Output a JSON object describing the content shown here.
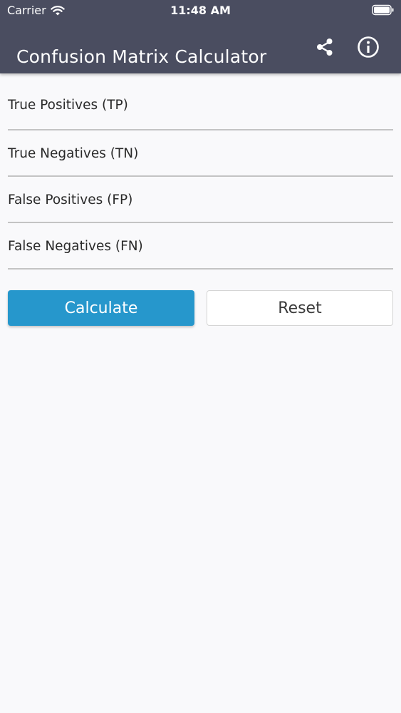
{
  "status_bar": {
    "carrier": "Carrier",
    "time": "11:48 AM"
  },
  "header": {
    "title": "Confusion Matrix Calculator",
    "share_icon": "share-icon",
    "info_icon": "info-icon"
  },
  "form": {
    "fields": [
      {
        "label": "True Positives (TP)"
      },
      {
        "label": "True Negatives (TN)"
      },
      {
        "label": "False Positives (FP)"
      },
      {
        "label": "False Negatives (FN)"
      }
    ]
  },
  "actions": {
    "calculate_label": "Calculate",
    "reset_label": "Reset"
  },
  "colors": {
    "header_bg": "#4a4d60",
    "primary": "#2697cc",
    "background": "#f9f9fb"
  }
}
